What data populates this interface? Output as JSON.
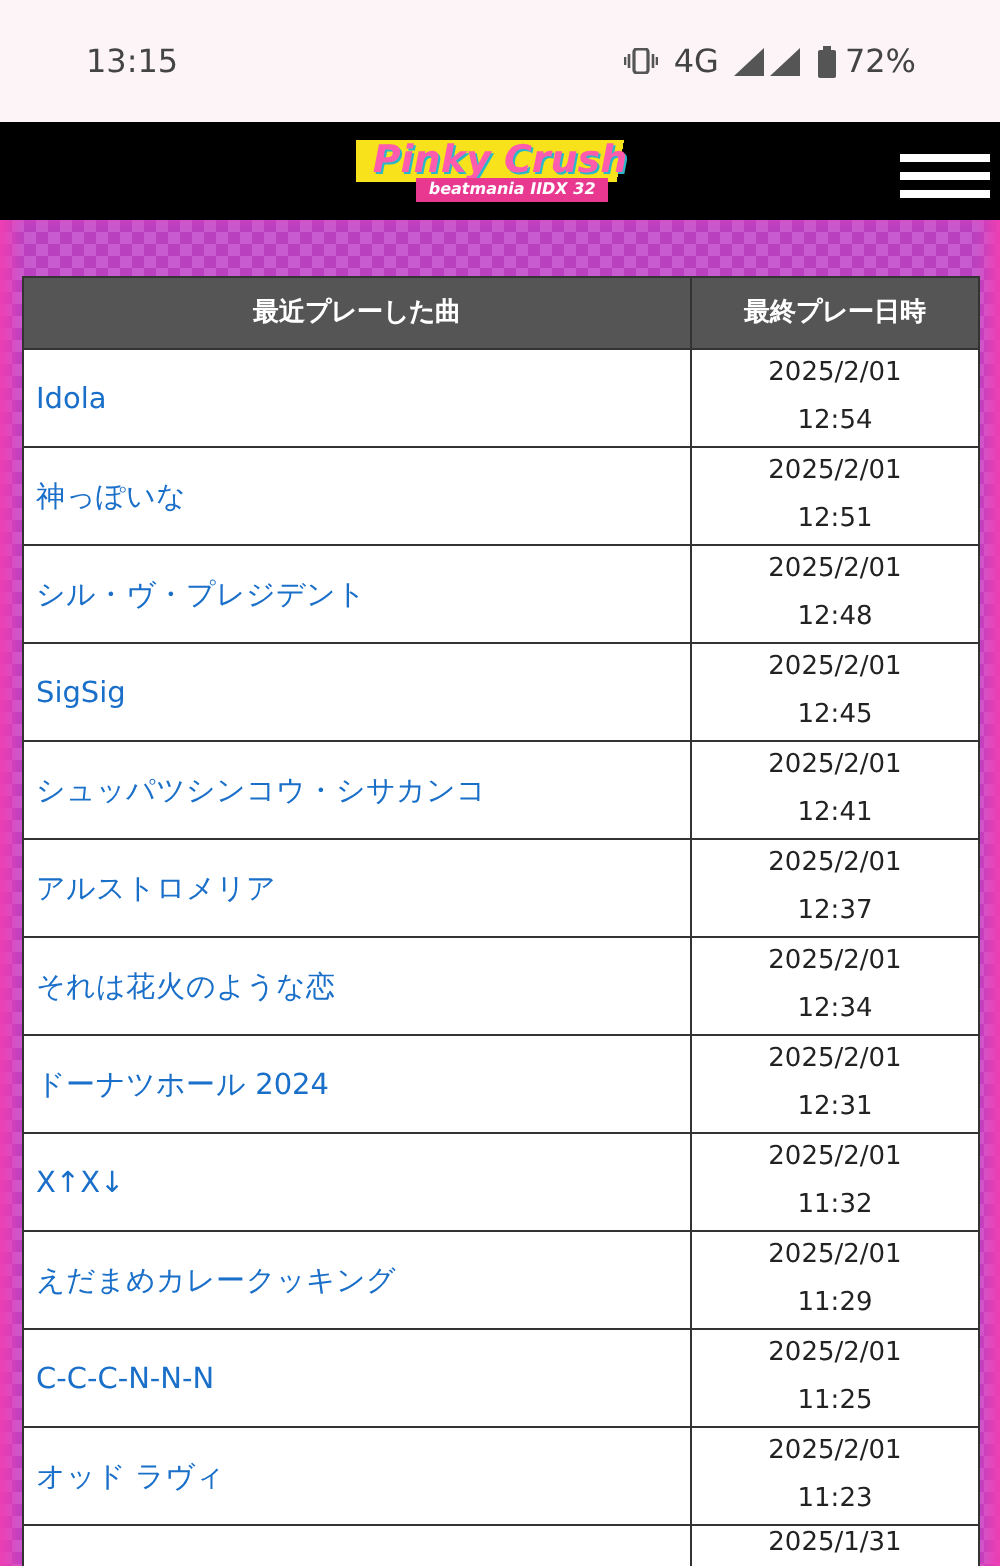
{
  "status_bar": {
    "time": "13:15",
    "network": "4G",
    "battery": "72%"
  },
  "header": {
    "logo_title": "Pinky Crush",
    "logo_subtitle": "beatmania IIDX 32"
  },
  "table": {
    "columns": [
      "最近プレーした曲",
      "最終プレー日時"
    ],
    "rows": [
      {
        "song": "Idola",
        "date": "2025/2/01",
        "time": "12:54"
      },
      {
        "song": "神っぽいな",
        "date": "2025/2/01",
        "time": "12:51"
      },
      {
        "song": "シル・ヴ・プレジデント",
        "date": "2025/2/01",
        "time": "12:48"
      },
      {
        "song": "SigSig",
        "date": "2025/2/01",
        "time": "12:45"
      },
      {
        "song": "シュッパツシンコウ・シサカンコ",
        "date": "2025/2/01",
        "time": "12:41"
      },
      {
        "song": "アルストロメリア",
        "date": "2025/2/01",
        "time": "12:37"
      },
      {
        "song": "それは花火のような恋",
        "date": "2025/2/01",
        "time": "12:34"
      },
      {
        "song": "ドーナツホール 2024",
        "date": "2025/2/01",
        "time": "12:31"
      },
      {
        "song": "X↑X↓",
        "date": "2025/2/01",
        "time": "11:32"
      },
      {
        "song": "えだまめカレークッキング",
        "date": "2025/2/01",
        "time": "11:29"
      },
      {
        "song": "C-C-C-N-N-N",
        "date": "2025/2/01",
        "time": "11:25"
      },
      {
        "song": "オッド ラヴィ",
        "date": "2025/2/01",
        "time": "11:23"
      },
      {
        "date": "2025/1/31"
      }
    ]
  }
}
